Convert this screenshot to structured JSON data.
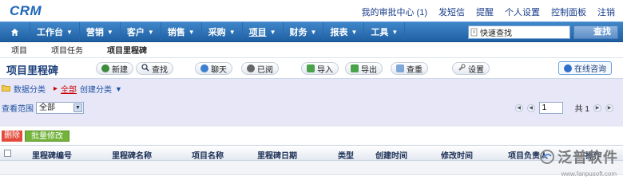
{
  "app": {
    "logo": "CRM"
  },
  "toplinks": [
    "我的审批中心 (1)",
    "发短信",
    "提醒",
    "个人设置",
    "控制面板",
    "注销"
  ],
  "nav": {
    "items": [
      {
        "label": "工作台",
        "caret": "▼"
      },
      {
        "label": "营销",
        "caret": "▼"
      },
      {
        "label": "客户",
        "caret": "▼"
      },
      {
        "label": "销售",
        "caret": "▼"
      },
      {
        "label": "采购",
        "caret": "▼"
      },
      {
        "label": "项目",
        "caret": "▼"
      },
      {
        "label": "财务",
        "caret": "▼"
      },
      {
        "label": "报表",
        "caret": "▼"
      },
      {
        "label": "工具",
        "caret": "▼"
      }
    ],
    "active_index": 5,
    "search_value": "快速查找",
    "search_button": "查找"
  },
  "subnav": [
    "项目",
    "项目任务",
    "项目里程碑"
  ],
  "page_title": "项目里程碑",
  "toolbar": {
    "new": "新建",
    "find": "查找",
    "chat": "聊天",
    "read": "已阅",
    "import": "导入",
    "export": "导出",
    "dedupe": "查重",
    "settings": "设置",
    "online": "在线咨询"
  },
  "category": {
    "label": "数据分类",
    "all": "全部",
    "created": "创建分类",
    "caret": "▼"
  },
  "scope": {
    "label": "查看范围",
    "value": "全部",
    "caret": "▼"
  },
  "pager": {
    "page": "1",
    "total": "共 1"
  },
  "actions": {
    "delete": "删除",
    "batch": "批量修改"
  },
  "table": {
    "columns": [
      "里程碑编号",
      "里程碑名称",
      "项目名称",
      "里程碑日期",
      "类型",
      "创建时间",
      "修改时间",
      "项目负责人",
      "操作"
    ]
  },
  "watermark": {
    "title": "泛普软件",
    "url": "www.fanpusoft.com"
  }
}
